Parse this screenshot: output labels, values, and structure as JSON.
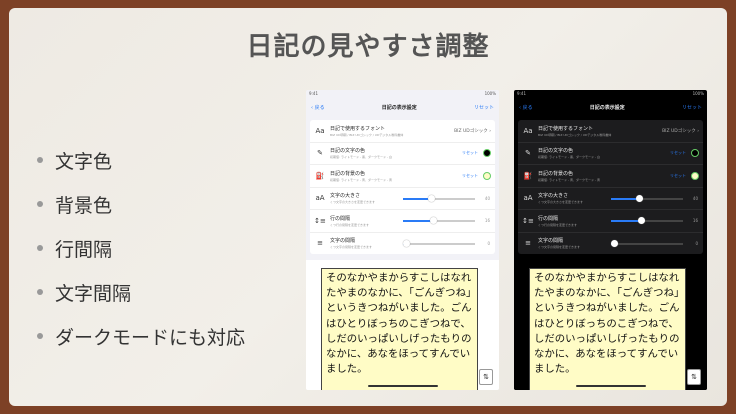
{
  "slide": {
    "title": "日記の見やすさ調整",
    "bullets": [
      "文字色",
      "背景色",
      "行間隔",
      "文字間隔",
      "ダークモードにも対応"
    ]
  },
  "screens": [
    {
      "theme": "light",
      "status_time": "9:41",
      "status_right": "100%",
      "nav": {
        "back": "戻る",
        "title": "日記の表示設定",
        "reset": "リセット"
      },
      "rows": [
        {
          "icon": "font-icon",
          "glyph": "Aa",
          "label": "日記で使用するフォント",
          "sub": "BIZ UD明朝 / BIZ UDゴシック / UDデジタル教科書体",
          "value": "BIZ UDゴシック"
        },
        {
          "icon": "pen-icon",
          "glyph": "✎",
          "label": "日記の文字の色",
          "sub": "初期値: ライトモード - 黒、ダークモード - 白",
          "reset": "リセット",
          "swatch": "#000000"
        },
        {
          "icon": "paint-bucket-icon",
          "glyph": "⛽",
          "label": "日記の背景の色",
          "sub": "初期値: ライトモード - 黄、ダークモード - 黄",
          "reset": "リセット",
          "swatch": "#fffcc6"
        },
        {
          "icon": "text-size-icon",
          "glyph": "aA",
          "label": "文字の大きさ",
          "sub": "くつ文字の大きさを変更できます",
          "level": 0.4,
          "value": "40"
        },
        {
          "icon": "line-spacing-icon",
          "glyph": "↕≡",
          "label": "行の間隔",
          "sub": "くつ行の間隔を変更できます",
          "level": 0.42,
          "value": "16"
        },
        {
          "icon": "letter-spacing-icon",
          "glyph": "≡",
          "label": "文字の間隔",
          "sub": "くつ文字の間隔を変更できます",
          "level": 0.05,
          "value": "0"
        }
      ],
      "preview_text": "そのなかやまからすこしはなれたやまのなかに、「ごんぎつね」というきつねがいました。ごんはひとりぼっちのこぎつねで、しだのいっぱいしげったもりのなかに、あなをほってすんでいました。"
    },
    {
      "theme": "dark",
      "status_time": "9:41",
      "status_right": "100%",
      "nav": {
        "back": "戻る",
        "title": "日記の表示設定",
        "reset": "リセット"
      },
      "rows": [
        {
          "icon": "font-icon",
          "glyph": "Aa",
          "label": "日記で使用するフォント",
          "sub": "BIZ UD明朝 / BIZ UDゴシック / UDデジタル教科書体",
          "value": "BIZ UDゴシック"
        },
        {
          "icon": "pen-icon",
          "glyph": "✎",
          "label": "日記の文字の色",
          "sub": "初期値: ライトモード - 黒、ダークモード - 白",
          "reset": "リセット",
          "swatch": "#000000"
        },
        {
          "icon": "paint-bucket-icon",
          "glyph": "⛽",
          "label": "日記の背景の色",
          "sub": "初期値: ライトモード - 黄、ダークモード - 黄",
          "reset": "リセット",
          "swatch": "#fffcc6"
        },
        {
          "icon": "text-size-icon",
          "glyph": "aA",
          "label": "文字の大きさ",
          "sub": "くつ文字の大きさを変更できます",
          "level": 0.4,
          "value": "40"
        },
        {
          "icon": "line-spacing-icon",
          "glyph": "↕≡",
          "label": "行の間隔",
          "sub": "くつ行の間隔を変更できます",
          "level": 0.42,
          "value": "16"
        },
        {
          "icon": "letter-spacing-icon",
          "glyph": "≡",
          "label": "文字の間隔",
          "sub": "くつ文字の間隔を変更できます",
          "level": 0.05,
          "value": "0"
        }
      ],
      "preview_text": "そのなかやまからすこしはなれたやまのなかに、「ごんぎつね」というきつねがいました。ごんはひとりぼっちのこぎつねで、しだのいっぱいしげったもりのなかに、あなをほってすんでいました。"
    }
  ]
}
